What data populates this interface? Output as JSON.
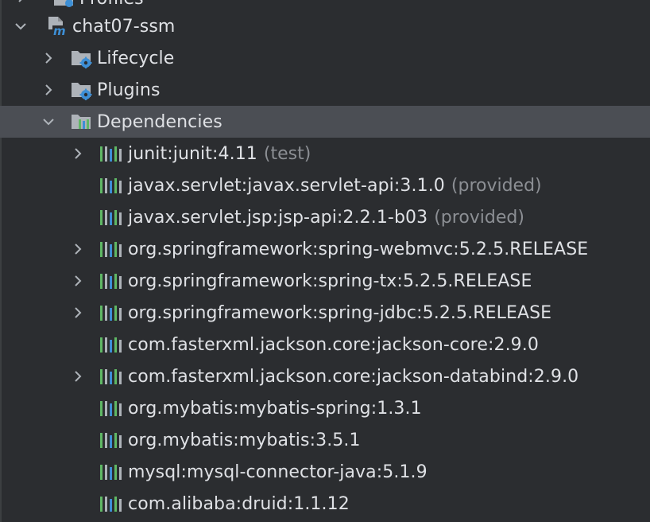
{
  "tree": {
    "top_partial": {
      "label": "Profiles"
    },
    "project": {
      "label": "chat07-ssm"
    },
    "lifecycle": {
      "label": "Lifecycle"
    },
    "plugins": {
      "label": "Plugins"
    },
    "dependencies": {
      "label": "Dependencies",
      "items": [
        {
          "label": "junit:junit:4.11",
          "scope": "(test)",
          "expandable": true
        },
        {
          "label": "javax.servlet:javax.servlet-api:3.1.0",
          "scope": "(provided)",
          "expandable": false
        },
        {
          "label": "javax.servlet.jsp:jsp-api:2.2.1-b03",
          "scope": "(provided)",
          "expandable": false
        },
        {
          "label": "org.springframework:spring-webmvc:5.2.5.RELEASE",
          "scope": "",
          "expandable": true
        },
        {
          "label": "org.springframework:spring-tx:5.2.5.RELEASE",
          "scope": "",
          "expandable": true
        },
        {
          "label": "org.springframework:spring-jdbc:5.2.5.RELEASE",
          "scope": "",
          "expandable": true
        },
        {
          "label": "com.fasterxml.jackson.core:jackson-core:2.9.0",
          "scope": "",
          "expandable": false
        },
        {
          "label": "com.fasterxml.jackson.core:jackson-databind:2.9.0",
          "scope": "",
          "expandable": true
        },
        {
          "label": "org.mybatis:mybatis-spring:1.3.1",
          "scope": "",
          "expandable": false
        },
        {
          "label": "org.mybatis:mybatis:3.5.1",
          "scope": "",
          "expandable": false
        },
        {
          "label": "mysql:mysql-connector-java:5.1.9",
          "scope": "",
          "expandable": false
        },
        {
          "label": "com.alibaba:druid:1.1.12",
          "scope": "",
          "expandable": false
        }
      ]
    }
  },
  "colors": {
    "background": "#2b2d30",
    "selected_row": "#4b4e54",
    "text": "#dfe1e5",
    "scope_text": "#8c8f94",
    "icon_blue": "#3d8fd6",
    "icon_green": "#5fb865",
    "icon_gray": "#aeb3b9"
  },
  "icons": {
    "chevron_expanded": "chevron-down-icon",
    "chevron_collapsed": "chevron-right-icon",
    "project": "maven-module-icon",
    "folder_settings": "folder-gear-icon",
    "dependencies": "library-folder-icon",
    "dependency": "library-icon"
  }
}
